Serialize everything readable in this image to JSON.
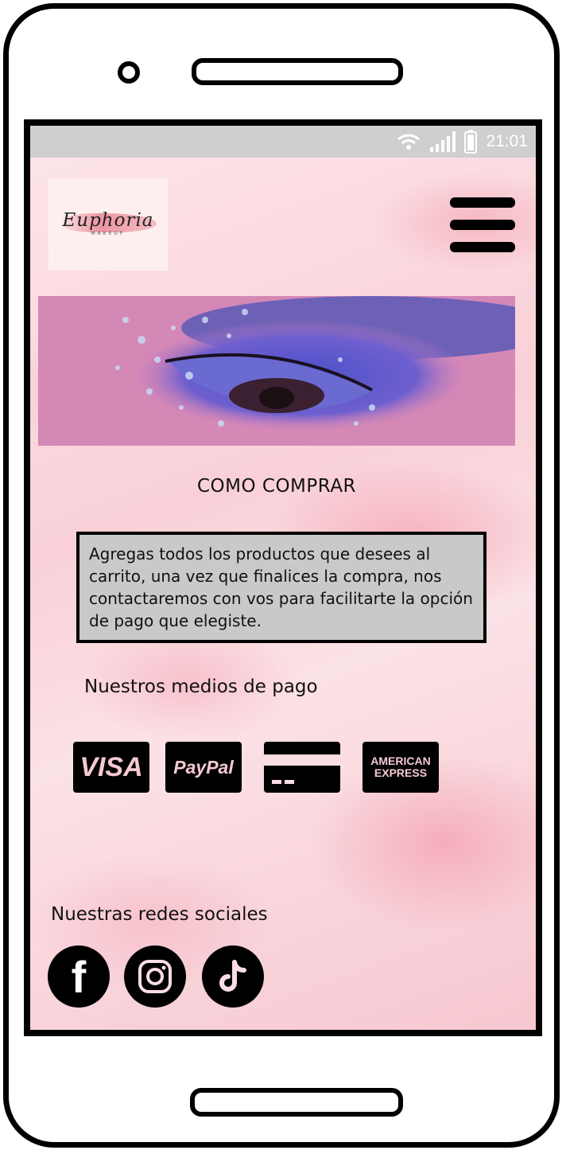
{
  "status_bar": {
    "time": "21:01",
    "icons": [
      "wifi-icon",
      "signal-icon",
      "battery-icon"
    ]
  },
  "header": {
    "logo_text": "Euphoria",
    "logo_subtext": "MAKEUP",
    "menu_icon": "hamburger-menu-icon"
  },
  "main": {
    "title": "COMO COMPRAR",
    "info_text": "Agregas todos los productos que desees al carrito, una vez que finalices la compra, nos contactaremos con vos para facilitarte la opción de pago que elegiste.",
    "payments_title": "Nuestros medios de pago",
    "payments": [
      {
        "label": "VISA",
        "icon": "visa-icon"
      },
      {
        "label": "PayPal",
        "icon": "paypal-icon"
      },
      {
        "label": "",
        "icon": "credit-card-icon"
      },
      {
        "label": "AMERICAN EXPRESS",
        "icon": "amex-icon"
      }
    ],
    "social_title": "Nuestras redes sociales",
    "social": [
      {
        "label": "f",
        "icon": "facebook-icon"
      },
      {
        "icon": "instagram-icon"
      },
      {
        "icon": "tiktok-icon"
      }
    ]
  },
  "colors": {
    "background": "#fbdde3",
    "statusbar": "#cfcfcf",
    "infobox": "#c9c9c9",
    "payment_text": "#f4c9d2"
  }
}
